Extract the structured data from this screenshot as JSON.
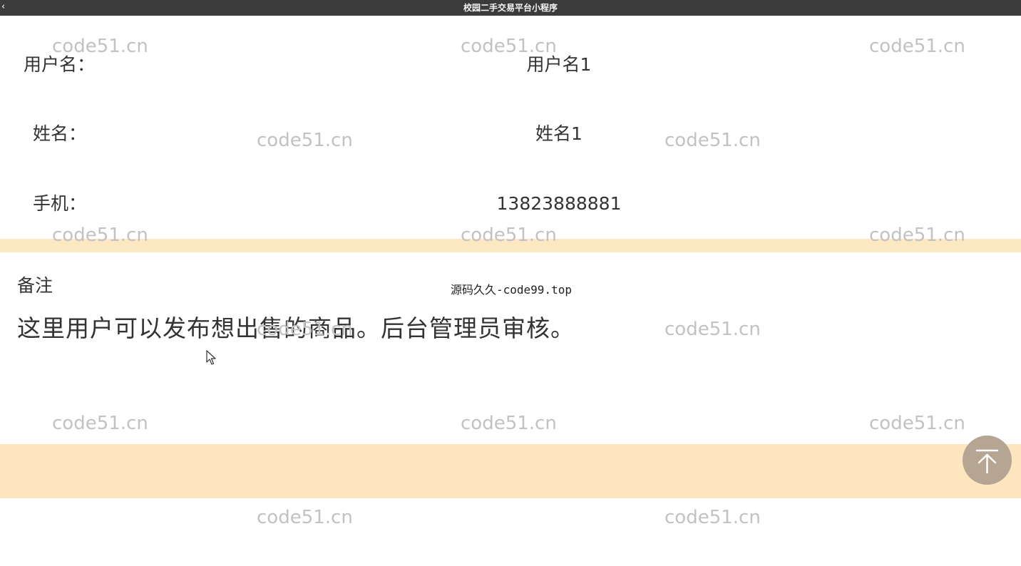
{
  "window": {
    "title": "校园二手交易平台小程序",
    "back_glyph": "‹"
  },
  "profile": {
    "username_label": "用户名：",
    "username_value": "用户名1",
    "name_label": "姓名：",
    "name_value": "姓名1",
    "phone_label": "手机：",
    "phone_value": "13823888881"
  },
  "remark": {
    "label": "备注",
    "text": "这里用户可以发布想出售的商品。后台管理员审核。"
  },
  "overlay": {
    "source_watermark": "源码久久-code99.top",
    "watermark_text": "code51.cn"
  },
  "controls": {
    "back_to_top_icon": "arrow-up-to-top-icon"
  },
  "colors": {
    "titlebar_bg": "#3b3b3b",
    "band_bg": "#fde8c4",
    "watermark": "#c2c2c2",
    "back_to_top_bg": "#b5a592"
  }
}
